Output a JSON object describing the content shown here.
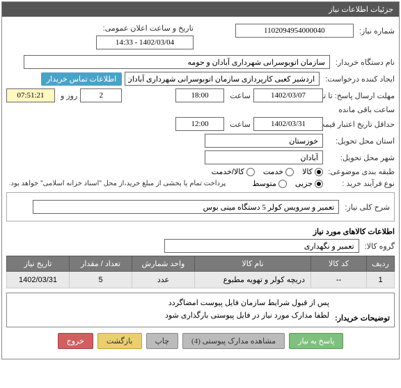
{
  "panel_title": "جزئیات اطلاعات نیاز",
  "labels": {
    "need_no": "شماره نیاز:",
    "buyer_org": "نام دستگاه خریدار:",
    "requester": "ایجاد کننده درخواست:",
    "send_deadline": "مهلت ارسال پاسخ: تا تاریخ:",
    "validity_min": "حداقل تاریخ اعتبار قیمت: تا تاریخ:",
    "province": "استان محل تحویل:",
    "city": "شهر محل تحویل:",
    "subject_class": "طبقه بندی موضوعی:",
    "buy_process": "نوع فرآیند خرید :",
    "public_date": "تاریخ و ساعت اعلان عمومی:",
    "hour": "ساعت",
    "and": "و",
    "day": "روز و",
    "remaining": "ساعت باقی مانده",
    "contact_info": "اطلاعات تماس خریدار",
    "need_summary": "شرح کلی نیاز:",
    "items_title": "اطلاعات کالاهای مورد نیاز",
    "group": "گروه کالا:",
    "buyer_notes": "توضیحات خریدار:"
  },
  "values": {
    "need_no": "1102094954000040",
    "public_date": "1402/03/04 - 14:33",
    "buyer_org": "سازمان اتوبوسرانی شهرداری آبادان و حومه",
    "requester": "اردشیر کعبی کارپردازی سازمان اتوبوسرانی شهرداری آبادان و حومه",
    "deadline_date": "1402/03/07",
    "deadline_time": "18:00",
    "remain_days": "2",
    "remain_time": "07:51:21",
    "validity_date": "1402/03/31",
    "validity_time": "12:00",
    "province": "خوزستان",
    "city": "آبادان",
    "need_summary": "تعمیر و سرویس کولر 5 دستگاه مینی بوس",
    "group": "تعمیر و نگهداری",
    "payment_note": "پرداخت تمام یا بخشی از مبلغ خرید،از محل \"اسناد خزانه اسلامی\" خواهد بود.",
    "buyer_notes_l1": "پس از قبول شرایط سازمان فایل پیوست امضاگردد",
    "buyer_notes_l2": "لطفا مدارک مورد نیاز در فایل پیوستی بارگذاری شود"
  },
  "subject_options": {
    "goods": "کالا",
    "service": "خدمت",
    "both": "کالا/خدمت"
  },
  "process_options": {
    "minor": "جزیی",
    "medium": "متوسط"
  },
  "table": {
    "headers": {
      "row": "ردیف",
      "code": "کد کالا",
      "name": "نام کالا",
      "unit": "واحد شمارش",
      "qty": "تعداد / مقدار",
      "date": "تاریخ نیاز"
    },
    "rows": [
      {
        "row": "1",
        "code": "--",
        "name": "دریچه کولر و تهویه مطبوع",
        "unit": "عدد",
        "qty": "5",
        "date": "1402/03/31"
      }
    ]
  },
  "buttons": {
    "respond": "پاسخ به نیاز",
    "attachments": "مشاهده مدارک پیوستی (4)",
    "print": "چاپ",
    "back": "بازگشت",
    "exit": "خروج"
  }
}
